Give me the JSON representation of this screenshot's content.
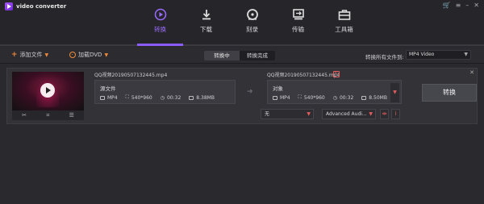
{
  "app": {
    "name": "video converter"
  },
  "window_controls": [
    "cart-icon",
    "menu-icon",
    "minimize-icon",
    "close-icon"
  ],
  "nav": {
    "items": [
      {
        "label": "转换",
        "icon": "convert-icon",
        "active": true
      },
      {
        "label": "下载",
        "icon": "download-icon",
        "active": false
      },
      {
        "label": "刻录",
        "icon": "burn-disc-icon",
        "active": false
      },
      {
        "label": "传输",
        "icon": "transfer-icon",
        "active": false
      },
      {
        "label": "工具箱",
        "icon": "toolbox-icon",
        "active": false
      }
    ]
  },
  "toolbar": {
    "add_files": "添加文件",
    "load_dvd": "加载DVD",
    "tabs": [
      "转换中",
      "转换完成"
    ],
    "convert_all_label": "转换所有文件到:",
    "format_value": "MP4 Video"
  },
  "task": {
    "source": {
      "filename": "QQ视频20190507132445.mp4",
      "box_title": "源文件",
      "format": "MP4",
      "resolution": "540*960",
      "duration": "00:32",
      "size": "8.38MB"
    },
    "target": {
      "filename": "QQ视频20190507132445.mp4",
      "box_title": "对象",
      "format": "MP4",
      "resolution": "540*960",
      "duration": "00:32",
      "size": "8.50MB"
    },
    "subtitle_select": "无",
    "audio_select": "Advanced Audi...",
    "convert_button": "转换"
  },
  "colors": {
    "accent": "#8b5cf6",
    "orange": "#f08a3a",
    "red": "#e35d5d",
    "bg": "#2a2a2e"
  }
}
